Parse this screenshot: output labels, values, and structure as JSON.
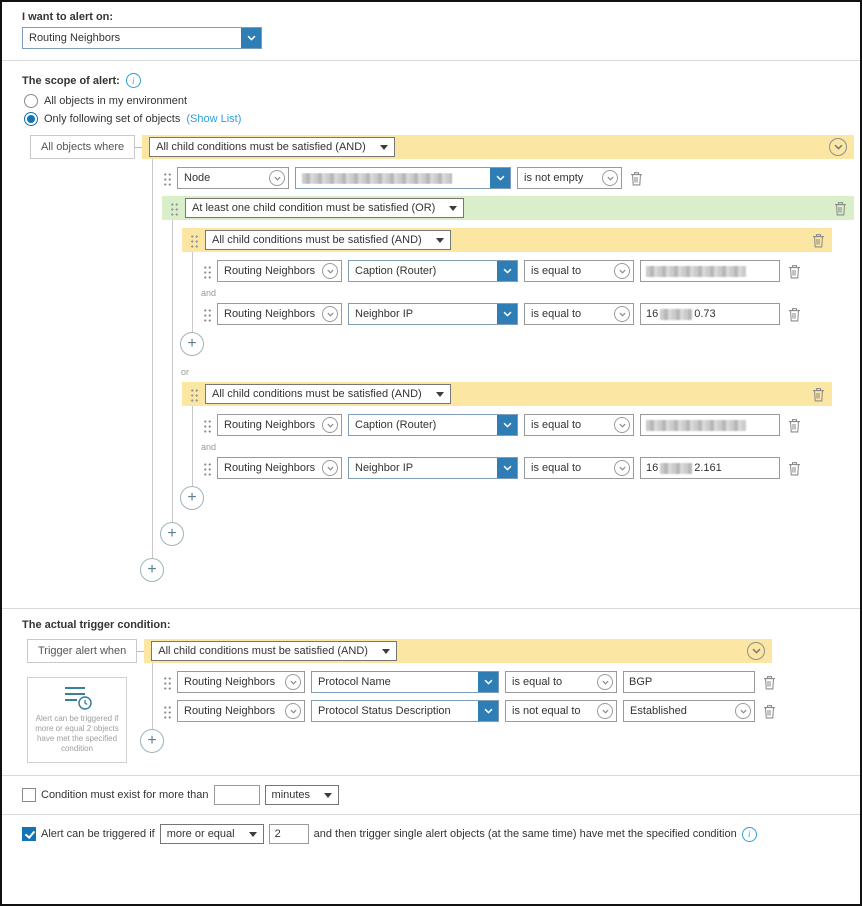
{
  "icons": {
    "plus": "+",
    "info": "i"
  },
  "header": {
    "label": "I want to alert on:",
    "select_value": "Routing Neighbors"
  },
  "scope": {
    "title": "The scope of alert:",
    "radios": {
      "all": "All objects in my environment",
      "subset": "Only following set of objects",
      "show_list": "(Show List)"
    },
    "where_label": "All objects where",
    "root_condition": "All child conditions must be satisfied (AND)",
    "node_row": {
      "field": "Node",
      "op": "is not empty"
    },
    "or_group": {
      "condition": "At least one child condition must be satisfied (OR)",
      "joiner": "or",
      "groups": [
        {
          "condition": "All child conditions must be satisfied (AND)",
          "joiner": "and",
          "rows": [
            {
              "object": "Routing Neighbors",
              "field": "Caption (Router)",
              "op": "is equal to",
              "value_prefix": "",
              "value_suffix": ""
            },
            {
              "object": "Routing Neighbors",
              "field": "Neighbor IP",
              "op": "is equal to",
              "value_prefix": "16",
              "value_suffix": "0.73"
            }
          ]
        },
        {
          "condition": "All child conditions must be satisfied (AND)",
          "joiner": "and",
          "rows": [
            {
              "object": "Routing Neighbors",
              "field": "Caption (Router)",
              "op": "is equal to",
              "value_prefix": "",
              "value_suffix": ""
            },
            {
              "object": "Routing Neighbors",
              "field": "Neighbor IP",
              "op": "is equal to",
              "value_prefix": "16",
              "value_suffix": "2.161"
            }
          ]
        }
      ]
    }
  },
  "trigger": {
    "title": "The actual trigger condition:",
    "when_label": "Trigger alert when",
    "root_condition": "All child conditions must be satisfied (AND)",
    "info_box": "Alert can be triggered if more or equal 2 objects have met the specified condition",
    "rows": [
      {
        "object": "Routing Neighbors",
        "field": "Protocol Name",
        "op": "is equal to",
        "value": "BGP"
      },
      {
        "object": "Routing Neighbors",
        "field": "Protocol Status Description",
        "op": "is not equal to",
        "value": "Established"
      }
    ]
  },
  "footer": {
    "condition_exist": {
      "label": "Condition must exist for more than",
      "minutes_value": "",
      "unit": "minutes"
    },
    "trigger_count": {
      "label": "Alert can be triggered if",
      "comparison": "more or equal",
      "count": "2",
      "suffix": "and then trigger single alert objects (at the same time) have met the specified condition"
    }
  }
}
